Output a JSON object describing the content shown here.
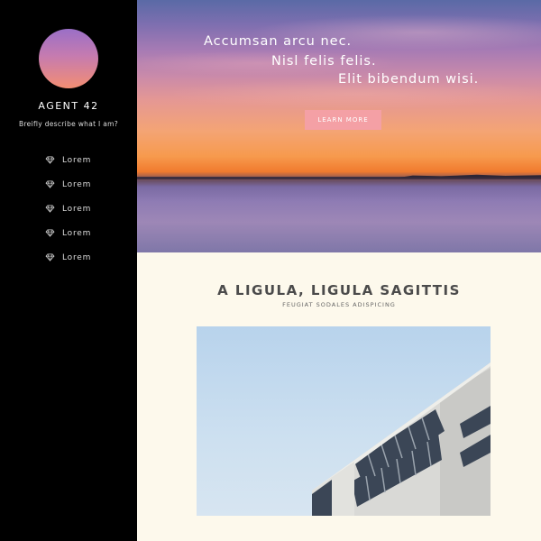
{
  "sidebar": {
    "title": "AGENT 42",
    "description": "Breifly describe what I am?",
    "nav": [
      {
        "label": "Lorem",
        "icon": "diamond-icon"
      },
      {
        "label": "Lorem",
        "icon": "diamond-icon"
      },
      {
        "label": "Lorem",
        "icon": "diamond-icon"
      },
      {
        "label": "Lorem",
        "icon": "diamond-icon"
      },
      {
        "label": "Lorem",
        "icon": "diamond-icon"
      }
    ]
  },
  "hero": {
    "lines": [
      "Accumsan arcu nec.",
      "Nisl felis felis.",
      "Elit bibendum wisi."
    ],
    "button_label": "LEARN MORE"
  },
  "section": {
    "title": "A LIGULA, LIGULA SAGITTIS",
    "subtitle": "FEUGIAT SODALES ADISPICING"
  },
  "colors": {
    "sidebar_bg": "#000000",
    "button_bg": "#f4a0a5",
    "content_bg": "#fdf9ec"
  }
}
